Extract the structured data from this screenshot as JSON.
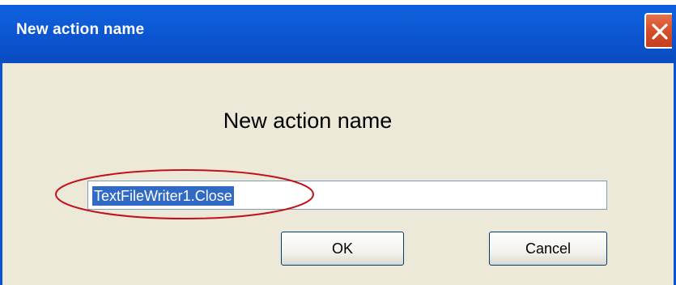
{
  "window": {
    "title": "New action name",
    "close_icon": "close-icon",
    "colors": {
      "titlebar": "#0b54cf",
      "close_button": "#d9502c",
      "client_background": "#ece9d8",
      "selection": "#316ac5",
      "annotation": "#c0121a"
    }
  },
  "dialog": {
    "heading": "New action name",
    "input": {
      "value": "TextFileWriter1.Close",
      "selected": true
    },
    "buttons": {
      "ok_label": "OK",
      "cancel_label": "Cancel"
    }
  }
}
